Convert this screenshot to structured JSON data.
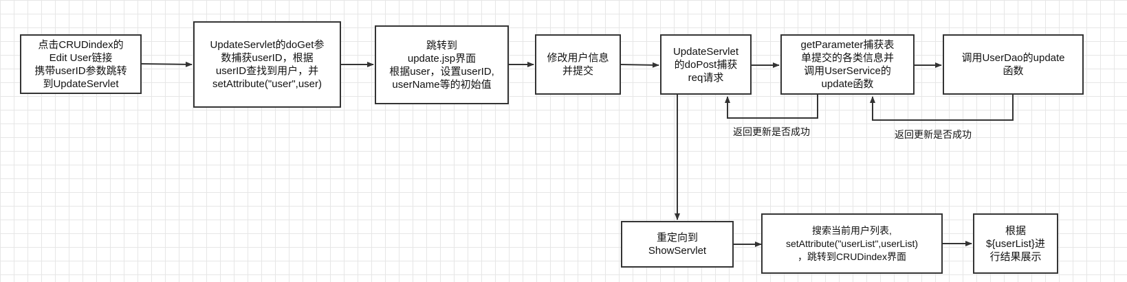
{
  "nodes": {
    "click_edit": "点击CRUDindex的\nEdit User链接\n携带userID参数跳转\n到UpdateServlet",
    "update_doget": "UpdateServlet的doGet参\n数捕获userID，根据\nuserID查找到用户，并\nsetAttribute(\"user\",user)",
    "to_update_jsp": "跳转到\nupdate.jsp界面\n根据user，设置userID,\nuserName等的初始值",
    "modify_submit": "修改用户信息\n并提交",
    "update_dopost": "UpdateServlet\n的doPost捕获\nreq请求",
    "get_parameter": "getParameter捕获表\n单提交的各类信息并\n调用UserService的\nupdate函数",
    "userdao_update": "调用UserDao的update\n函数",
    "redirect_show": "重定向到\nShowServlet",
    "search_list": "搜索当前用户列表,\nsetAttribute(\"userList\",userList)\n，跳转到CRUDindex界面",
    "display_result": "根据\n${userList}进\n行结果展示"
  },
  "edge_labels": {
    "return_success_1": "返回更新是否成功",
    "return_success_2": "返回更新是否成功"
  }
}
